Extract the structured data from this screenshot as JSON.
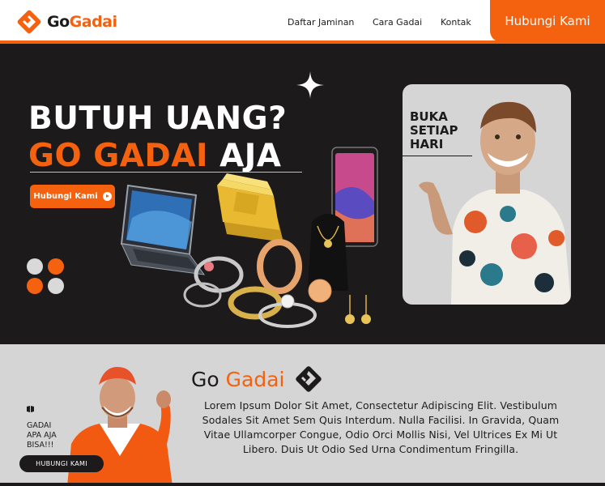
{
  "header": {
    "logo": {
      "go": "Go",
      "gadai": "Gadai"
    },
    "menu": [
      "Daftar Jaminan",
      "Cara Gadai",
      "Kontak"
    ],
    "cta_label": "Hubungi Kami"
  },
  "hero": {
    "title_line1": "BUTUH UANG?",
    "title_line2_highlight": "GO GADAI",
    "title_line2_rest": "AJA",
    "button_label": "Hubungi Kami",
    "promo_text": [
      "BUKA",
      "SETIAP",
      "HARI"
    ]
  },
  "about": {
    "title_go": "Go",
    "title_gadai": "Gadai",
    "description": "Lorem Ipsum Dolor Sit Amet, Consectetur Adipiscing Elit. Vestibulum Sodales Sit Amet Sem Quis Interdum. Nulla Facilisi. In Gravida, Quam Vitae Ullamcorper Congue, Odio Orci Mollis Nisi, Vel Ultrices Ex Mi Ut Libero. Duis Ut Odio Sed Urna Condimentum Fringilla.",
    "side_text": [
      "GADAI",
      "APA AJA",
      "BISA!!!"
    ],
    "side_button_label": "HUBUNGI KAMI"
  },
  "colors": {
    "accent": "#f5620f",
    "dark": "#1c1a1b",
    "light_gray": "#d6d5d6",
    "white": "#ffffff"
  },
  "icons": [
    "gogadai-logo-icon",
    "sparkle-icon",
    "play-icon",
    "book-icon"
  ]
}
